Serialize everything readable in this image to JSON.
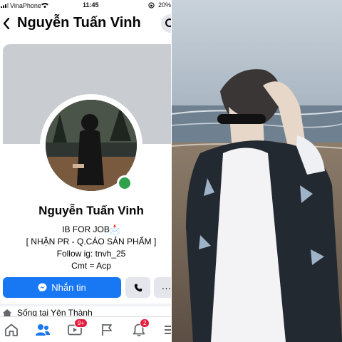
{
  "status_bar": {
    "carrier": "VinaPhone",
    "time": "11:45",
    "battery": "20%"
  },
  "header": {
    "title": "Nguyễn Tuấn Vinh"
  },
  "profile": {
    "name": "Nguyễn Tuấn Vinh",
    "bio": [
      "IB FOR JOB📩",
      "[ NHẬN PR - Q.CÁO SẢN PHẨM ]",
      "Follow ig: tnvh_25",
      "Cmt = Acp"
    ],
    "online": true
  },
  "actions": {
    "message_label": "Nhắn tin",
    "more_label": "···"
  },
  "details": {
    "lives_in": "Sống tại Yên Thành"
  },
  "tabbar": {
    "items": [
      "home-icon",
      "friends-icon",
      "video-icon",
      "pages-icon",
      "notifications-icon",
      "menu-icon"
    ],
    "video_badge": "9+",
    "notifications_badge": "2"
  },
  "colors": {
    "accent": "#1877f2",
    "online": "#31a24c",
    "badge": "#e41e3f"
  }
}
